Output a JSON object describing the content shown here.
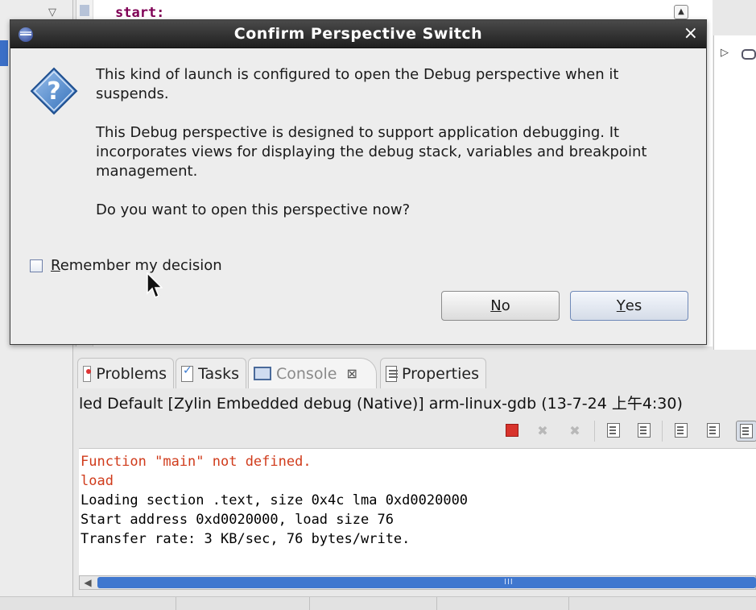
{
  "background": {
    "editor_code": "start:",
    "console_tabs": [
      {
        "label": "Problems"
      },
      {
        "label": "Tasks"
      },
      {
        "label": "Console",
        "close_glyph": "⊠"
      },
      {
        "label": "Properties"
      }
    ],
    "console_title": "led Default [Zylin Embedded debug (Native)] arm-linux-gdb (13-7-24 上午4:30)",
    "console_lines": [
      {
        "text": "Function \"main\" not defined.",
        "color": "#d03b1b"
      },
      {
        "text": "load",
        "color": "#d03b1b"
      },
      {
        "text": "Loading section .text, size 0x4c lma 0xd0020000",
        "color": "#000000"
      },
      {
        "text": "Start address 0xd0020000, load size 76",
        "color": "#000000"
      },
      {
        "text": "Transfer rate: 3 KB/sec, 76 bytes/write.",
        "color": "#000000"
      }
    ],
    "scroll_grip": "III"
  },
  "dialog": {
    "title": "Confirm Perspective Switch",
    "close_glyph": "×",
    "icon": "question-icon",
    "paragraph1": "This kind of launch is configured to open the Debug perspective when it suspends.",
    "paragraph2": "This Debug perspective is designed to support application debugging.  It incorporates views for displaying the debug stack, variables and breakpoint management.",
    "paragraph3": "Do you want to open this perspective now?",
    "remember": {
      "first": "R",
      "rest": "emember my decision",
      "checked": false
    },
    "no_button": {
      "first": "N",
      "rest": "o"
    },
    "yes_button": {
      "first": "Y",
      "rest": "es"
    }
  },
  "colors": {
    "accent": "#3b6fc7",
    "error_text": "#d03b1b",
    "terminate": "#d8332c"
  }
}
